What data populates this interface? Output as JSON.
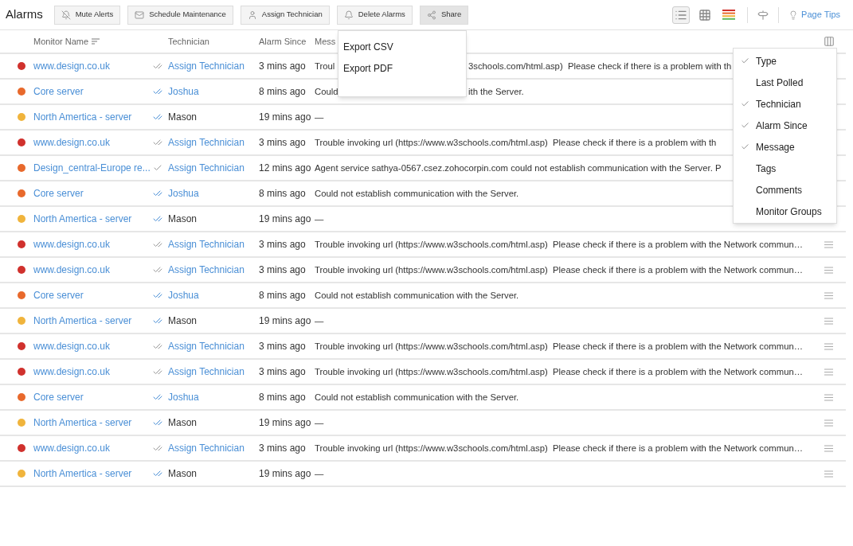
{
  "toolbar": {
    "title": "Alarms",
    "buttons": [
      {
        "kind": "mute",
        "label": "Mute Alerts",
        "selected": false
      },
      {
        "kind": "maintenance",
        "label": "Schedule Maintenance",
        "selected": false
      },
      {
        "kind": "assign",
        "label": "Assign Technician",
        "selected": false
      },
      {
        "kind": "delete",
        "label": "Delete Alarms",
        "selected": false
      },
      {
        "kind": "share",
        "label": "Share",
        "selected": true
      }
    ],
    "views": [
      {
        "kind": "list",
        "selected": true
      },
      {
        "kind": "grid",
        "selected": false
      },
      {
        "kind": "severity",
        "selected": false
      }
    ],
    "page_tips": "Page Tips"
  },
  "share_menu": {
    "items": [
      "Export CSV",
      "Export PDF"
    ]
  },
  "table": {
    "columns": [
      "Monitor Name",
      "Technician",
      "Alarm Since",
      "Mess"
    ],
    "rows": [
      {
        "color": "#d0312d",
        "monitor": "www.design.co.uk",
        "double_check": true,
        "assigned": false,
        "technician": "Assign Technician",
        "technician_link": true,
        "since": "3 mins ago",
        "message": [
          "Troul",
          "3schools.com/html.asp)  Please check if there is a problem with th"
        ],
        "handle": false
      },
      {
        "color": "#e8692c",
        "monitor": "Core server",
        "double_check": true,
        "assigned": true,
        "technician": "Joshua",
        "technician_link": true,
        "since": "8 mins ago",
        "message": [
          "Could",
          "ith the Server."
        ],
        "handle": false
      },
      {
        "color": "#f0b43c",
        "monitor": "North Amertica - server",
        "double_check": true,
        "assigned": true,
        "technician": "Mason",
        "technician_link": false,
        "since": "19 mins ago",
        "message": [
          "—"
        ],
        "handle": false
      },
      {
        "color": "#d0312d",
        "monitor": "www.design.co.uk",
        "double_check": true,
        "assigned": false,
        "technician": "Assign Technician",
        "technician_link": true,
        "since": "3 mins ago",
        "message": [
          "Trouble invoking url (https://www.w3schools.com/html.asp)  Please check if there is a problem with th"
        ],
        "handle": false
      },
      {
        "color": "#e8692c",
        "monitor": "Design_central-Europe re...",
        "double_check": false,
        "assigned": false,
        "technician": "Assign Technician",
        "technician_link": true,
        "since": "12 mins ago",
        "message": [
          "Agent service sathya-0567.csez.zohocorpin.com could not establish communication with the Server. P"
        ],
        "handle": false
      },
      {
        "color": "#e8692c",
        "monitor": "Core server",
        "double_check": true,
        "assigned": true,
        "technician": "Joshua",
        "technician_link": true,
        "since": "8 mins ago",
        "message": [
          "Could not establish communication with the Server."
        ],
        "handle": false
      },
      {
        "color": "#f0b43c",
        "monitor": "North Amertica - server",
        "double_check": true,
        "assigned": true,
        "technician": "Mason",
        "technician_link": false,
        "since": "19 mins ago",
        "message": [
          "—"
        ],
        "handle": false
      },
      {
        "color": "#d0312d",
        "monitor": "www.design.co.uk",
        "double_check": true,
        "assigned": false,
        "technician": "Assign Technician",
        "technician_link": true,
        "since": "3 mins ago",
        "message": [
          "Trouble invoking url (https://www.w3schools.com/html.asp)  Please check if there is a problem with the Network commun…"
        ],
        "handle": true
      },
      {
        "color": "#d0312d",
        "monitor": "www.design.co.uk",
        "double_check": true,
        "assigned": false,
        "technician": "Assign Technician",
        "technician_link": true,
        "since": "3 mins ago",
        "message": [
          "Trouble invoking url (https://www.w3schools.com/html.asp)  Please check if there is a problem with the Network commun…"
        ],
        "handle": true
      },
      {
        "color": "#e8692c",
        "monitor": "Core server",
        "double_check": true,
        "assigned": true,
        "technician": "Joshua",
        "technician_link": true,
        "since": "8 mins ago",
        "message": [
          "Could not establish communication with the Server."
        ],
        "handle": true
      },
      {
        "color": "#f0b43c",
        "monitor": "North Amertica - server",
        "double_check": true,
        "assigned": true,
        "technician": "Mason",
        "technician_link": false,
        "since": "19 mins ago",
        "message": [
          "—"
        ],
        "handle": true
      },
      {
        "color": "#d0312d",
        "monitor": "www.design.co.uk",
        "double_check": true,
        "assigned": false,
        "technician": "Assign Technician",
        "technician_link": true,
        "since": "3 mins ago",
        "message": [
          "Trouble invoking url (https://www.w3schools.com/html.asp)  Please check if there is a problem with the Network commun…"
        ],
        "handle": true
      },
      {
        "color": "#d0312d",
        "monitor": "www.design.co.uk",
        "double_check": true,
        "assigned": false,
        "technician": "Assign Technician",
        "technician_link": true,
        "since": "3 mins ago",
        "message": [
          "Trouble invoking url (https://www.w3schools.com/html.asp)  Please check if there is a problem with the Network commun…"
        ],
        "handle": true
      },
      {
        "color": "#e8692c",
        "monitor": "Core server",
        "double_check": true,
        "assigned": true,
        "technician": "Joshua",
        "technician_link": true,
        "since": "8 mins ago",
        "message": [
          "Could not establish communication with the Server."
        ],
        "handle": true
      },
      {
        "color": "#f0b43c",
        "monitor": "North Amertica - server",
        "double_check": true,
        "assigned": true,
        "technician": "Mason",
        "technician_link": false,
        "since": "19 mins ago",
        "message": [
          "—"
        ],
        "handle": true
      },
      {
        "color": "#d0312d",
        "monitor": "www.design.co.uk",
        "double_check": true,
        "assigned": false,
        "technician": "Assign Technician",
        "technician_link": true,
        "since": "3 mins ago",
        "message": [
          "Trouble invoking url (https://www.w3schools.com/html.asp)  Please check if there is a problem with the Network commun…"
        ],
        "handle": true
      },
      {
        "color": "#f0b43c",
        "monitor": "North Amertica - server",
        "double_check": true,
        "assigned": true,
        "technician": "Mason",
        "technician_link": false,
        "since": "19 mins ago",
        "message": [
          "—"
        ],
        "handle": true
      }
    ]
  },
  "column_menu": {
    "items": [
      {
        "label": "Type",
        "checked": true
      },
      {
        "label": "Last Polled",
        "checked": false
      },
      {
        "label": "Technician",
        "checked": true
      },
      {
        "label": "Alarm Since",
        "checked": true
      },
      {
        "label": "Message",
        "checked": true
      },
      {
        "label": "Tags",
        "checked": false
      },
      {
        "label": "Comments",
        "checked": false
      },
      {
        "label": "Monitor Groups",
        "checked": false
      }
    ]
  }
}
